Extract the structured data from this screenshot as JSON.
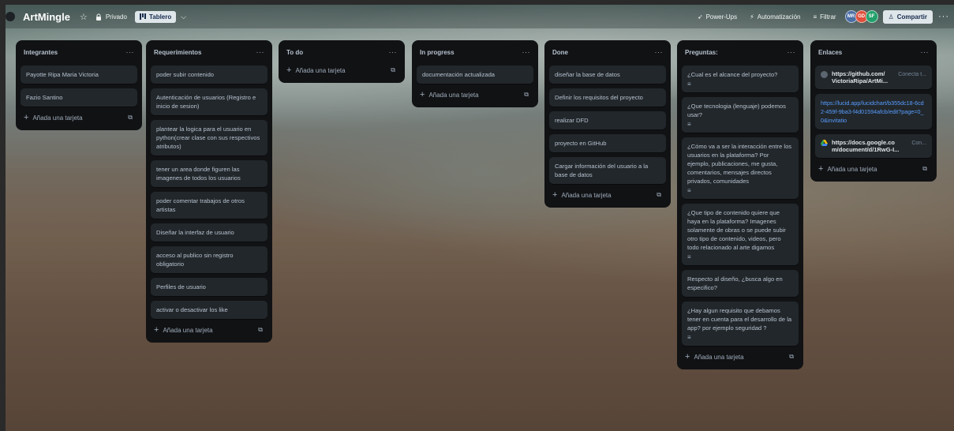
{
  "header": {
    "board_title": "ArtMingle",
    "privacy_label": "Privado",
    "view_label": "Tablero",
    "powerups_label": "Power-Ups",
    "automation_label": "Automatización",
    "filter_label": "Filtrar",
    "avatars": [
      {
        "initials": "MR",
        "color": "#4a6fa5"
      },
      {
        "initials": "GD",
        "color": "#e04f3a"
      },
      {
        "initials": "SF",
        "color": "#22a06b"
      }
    ],
    "share_label": "Compartir"
  },
  "add_card_label": "Añada una tarjeta",
  "lists": [
    {
      "title": "Integrantes",
      "cards": [
        "Payotte Ripa Maria Victoria",
        "Fazio Santino"
      ]
    },
    {
      "title": "Requerimientos",
      "cards": [
        "poder subir contenido",
        "Autenticación de usuarios (Registro e inicio de sesion)",
        "plantear la logica para el usuario en python(crear clase con sus respectivos atributos)",
        "tener un area donde figuren las imagenes de todos los usuarios",
        "poder comentar trabajos de otros artistas",
        "Diseñar la interfaz de usuario",
        "acceso al publico sin registro obligatorio",
        "Perfiles de usuario",
        "activar o desactivar los like"
      ]
    },
    {
      "title": "To do",
      "cards": []
    },
    {
      "title": "In progress",
      "cards": [
        "documentación actualizada"
      ]
    },
    {
      "title": "Done",
      "cards": [
        "diseñar la base de datos",
        "Definir los requisitos del proyecto",
        "realizar DFD",
        "proyecto en GitHub",
        "Cargar información del usuario a la base de datos"
      ]
    },
    {
      "title": "Preguntas:",
      "cards": [
        "¿Cual es el alcance del proyecto?",
        "¿Que tecnologia (lenguaje) podemos usar?",
        "¿Cómo va a ser la interacción entre los usuarios en la plataforma? Por ejemplo, publicaciones, me gusta, comentarios, mensajes directos privados, comunidades",
        "¿Que tipo de contenido quiere que haya en la plataforma? Imagenes solamente de obras o se puede subir otro tipo de contenido, videos, pero todo relacionado al arte digamos",
        "Respecto al diseño, ¿busca algo en especifico?",
        "¿Hay algun requisito que debamos tener en cuenta para el desarrollo de la app? por ejemplo seguridad ?"
      ]
    },
    {
      "title": "Enlaces",
      "cards": [
        "https://github.com/ VictoriaRipa/ArtMi...",
        "https://lucid.app/lucidchart/b355dc18-6cd2-459f-9ba3-f4d01594afcb/edit?page=0_0&invitatio",
        "https://docs.google.co m/document/d/1RwG-I..."
      ],
      "link_extra": [
        "Conecta t...",
        "",
        "Con..."
      ]
    }
  ]
}
